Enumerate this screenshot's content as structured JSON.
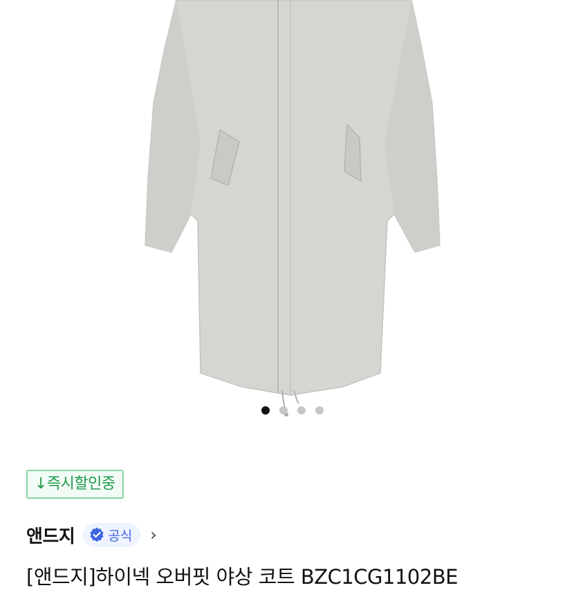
{
  "carousel": {
    "total": 4,
    "active_index": 0
  },
  "badge": {
    "label": "↓즉시할인중"
  },
  "seller": {
    "brand_name": "앤드지",
    "official_label": "공식"
  },
  "product": {
    "title": "[앤드지]하이넥 오버핏 야상 코트  BZC1CG1102BE"
  },
  "colors": {
    "tag_green": "#1e9a4a",
    "official_blue": "#3f66e0",
    "coat_gray": "#d6d5d1"
  }
}
